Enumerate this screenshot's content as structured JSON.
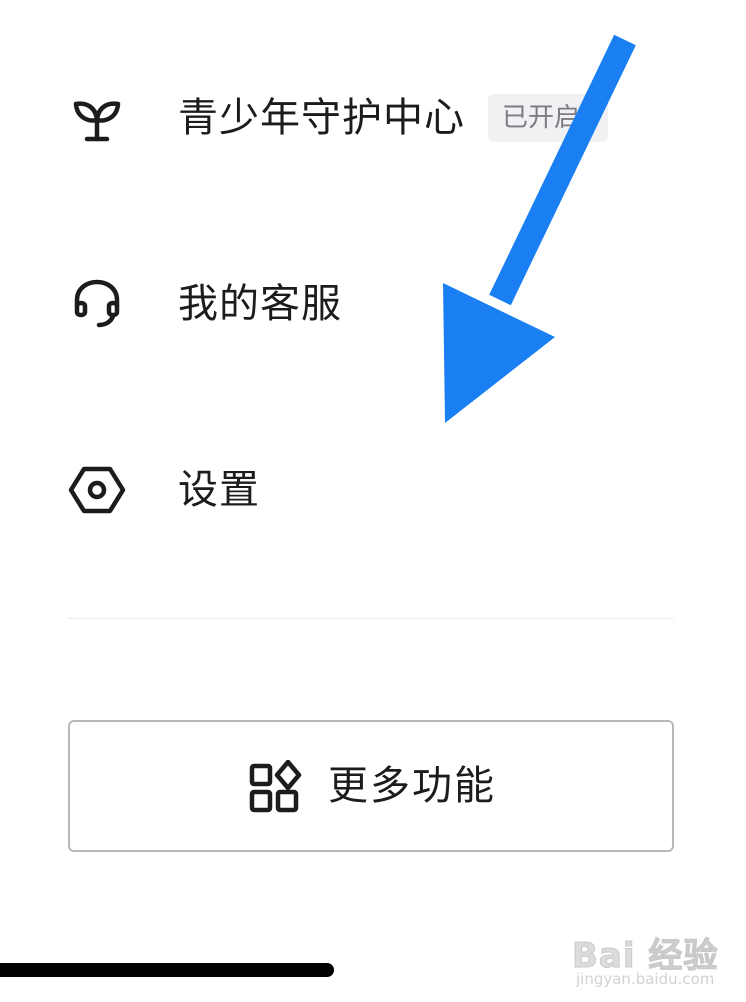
{
  "menu": {
    "items": [
      {
        "label": "青少年守护中心",
        "badge": "已开启",
        "icon": "sprout-icon"
      },
      {
        "label": "我的客服",
        "icon": "headset-icon"
      },
      {
        "label": "设置",
        "icon": "hexagon-settings-icon"
      }
    ]
  },
  "more_button": {
    "label": "更多功能",
    "icon": "apps-grid-icon"
  },
  "overlay": {
    "arrow_color": "#1a7ff2"
  },
  "watermark": {
    "logo": "Bai 经验",
    "url": "jingyan.baidu.com"
  },
  "colors": {
    "text": "#1c1c1e",
    "badge_bg": "#f1f1f3",
    "badge_text": "#7c7c80",
    "border": "#b8b8bc"
  }
}
